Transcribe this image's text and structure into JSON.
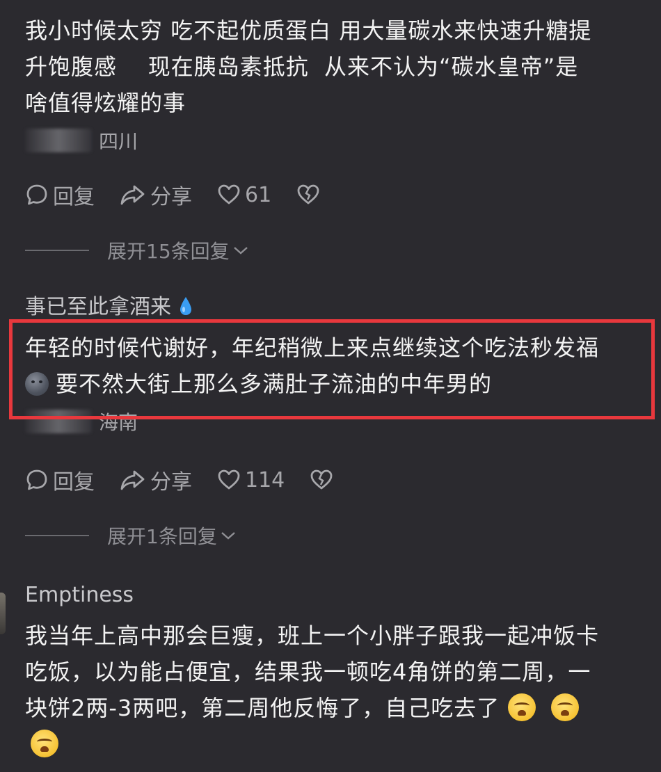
{
  "comments": [
    {
      "username": "",
      "lines": [
        "我小时候太穷  吃不起优质蛋白  用大量碳水来快速升糖提",
        "升饱腹感    现在胰岛素抵抗  从来不认为“碳水皇帝”是",
        "啥值得炫耀的事"
      ],
      "location": "四川",
      "reply_label": "回复",
      "share_label": "分享",
      "likes": "61",
      "expand_label": "展开15条回复"
    },
    {
      "username": "事已至此拿酒来",
      "lines": [
        "年轻的时候代谢好，年纪稍微上来点继续这个吃法秒发福",
        "要不然大街上那么多满肚子流油的中年男的"
      ],
      "location": "海南",
      "reply_label": "回复",
      "share_label": "分享",
      "likes": "114",
      "expand_label": "展开1条回复"
    },
    {
      "username": "Emptiness",
      "lines": [
        "我当年上高中那会巨瘦，班上一个小胖子跟我一起冲饭卡",
        "吃饭，以为能占便宜，结果我一顿吃4角饼的第二周，一",
        "块饼2两-3两吧，第二周他反悔了，自己吃去了"
      ]
    }
  ],
  "colors": {
    "background": "#2b2a2f",
    "highlight_border": "#e8383d",
    "secondary_text": "#a7a7ab"
  },
  "icons": [
    "comment-bubble-icon",
    "share-arrow-icon",
    "heart-icon",
    "broken-heart-icon",
    "chevron-down-icon",
    "water-drop-icon",
    "dark-moon-face-emoji",
    "crying-face-emoji"
  ]
}
